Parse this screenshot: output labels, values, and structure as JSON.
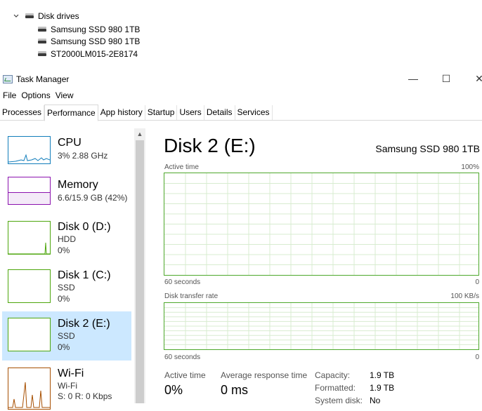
{
  "device_tree": {
    "category_label": "Disk drives",
    "drives": [
      "Samsung SSD 980 1TB",
      "Samsung SSD 980 1TB",
      "ST2000LM015-2E8174"
    ]
  },
  "window": {
    "title": "Task Manager",
    "minimize_glyph": "—",
    "maximize_glyph": "☐",
    "close_glyph": "✕"
  },
  "menu": [
    "File",
    "Options",
    "View"
  ],
  "tabs": [
    "Processes",
    "Performance",
    "App history",
    "Startup",
    "Users",
    "Details",
    "Services"
  ],
  "active_tab": "Performance",
  "sidebar": [
    {
      "title": "CPU",
      "lines": [
        "3% 2.88 GHz"
      ],
      "color": "#117dbb",
      "selected": false
    },
    {
      "title": "Memory",
      "lines": [
        "6.6/15.9 GB (42%)"
      ],
      "color": "#8b12ae",
      "selected": false
    },
    {
      "title": "Disk 0 (D:)",
      "lines": [
        "HDD",
        "0%"
      ],
      "color": "#4da60c",
      "selected": false
    },
    {
      "title": "Disk 1 (C:)",
      "lines": [
        "SSD",
        "0%"
      ],
      "color": "#4da60c",
      "selected": false
    },
    {
      "title": "Disk 2 (E:)",
      "lines": [
        "SSD",
        "0%"
      ],
      "color": "#4da60c",
      "selected": true
    },
    {
      "title": "Wi-Fi",
      "lines": [
        "Wi-Fi",
        "S: 0 R: 0 Kbps"
      ],
      "color": "#a74f01",
      "selected": false
    }
  ],
  "detail": {
    "title": "Disk 2 (E:)",
    "model": "Samsung SSD 980 1TB",
    "graph1": {
      "label": "Active time",
      "max_label": "100%",
      "time_label": "60 seconds",
      "min_label": "0",
      "level_percent": 0
    },
    "graph2": {
      "label": "Disk transfer rate",
      "max_label": "100 KB/s",
      "time_label": "60 seconds",
      "min_label": "0",
      "level_percent": 0
    },
    "stats": [
      {
        "label": "Active time",
        "value": "0%"
      },
      {
        "label": "Average response time",
        "value": "0 ms"
      }
    ],
    "properties": [
      {
        "key": "Capacity:",
        "value": "1.9 TB"
      },
      {
        "key": "Formatted:",
        "value": "1.9 TB"
      },
      {
        "key": "System disk:",
        "value": "No"
      }
    ]
  },
  "colors": {
    "accent_green": "#4da82b",
    "selection": "#cce8ff"
  }
}
